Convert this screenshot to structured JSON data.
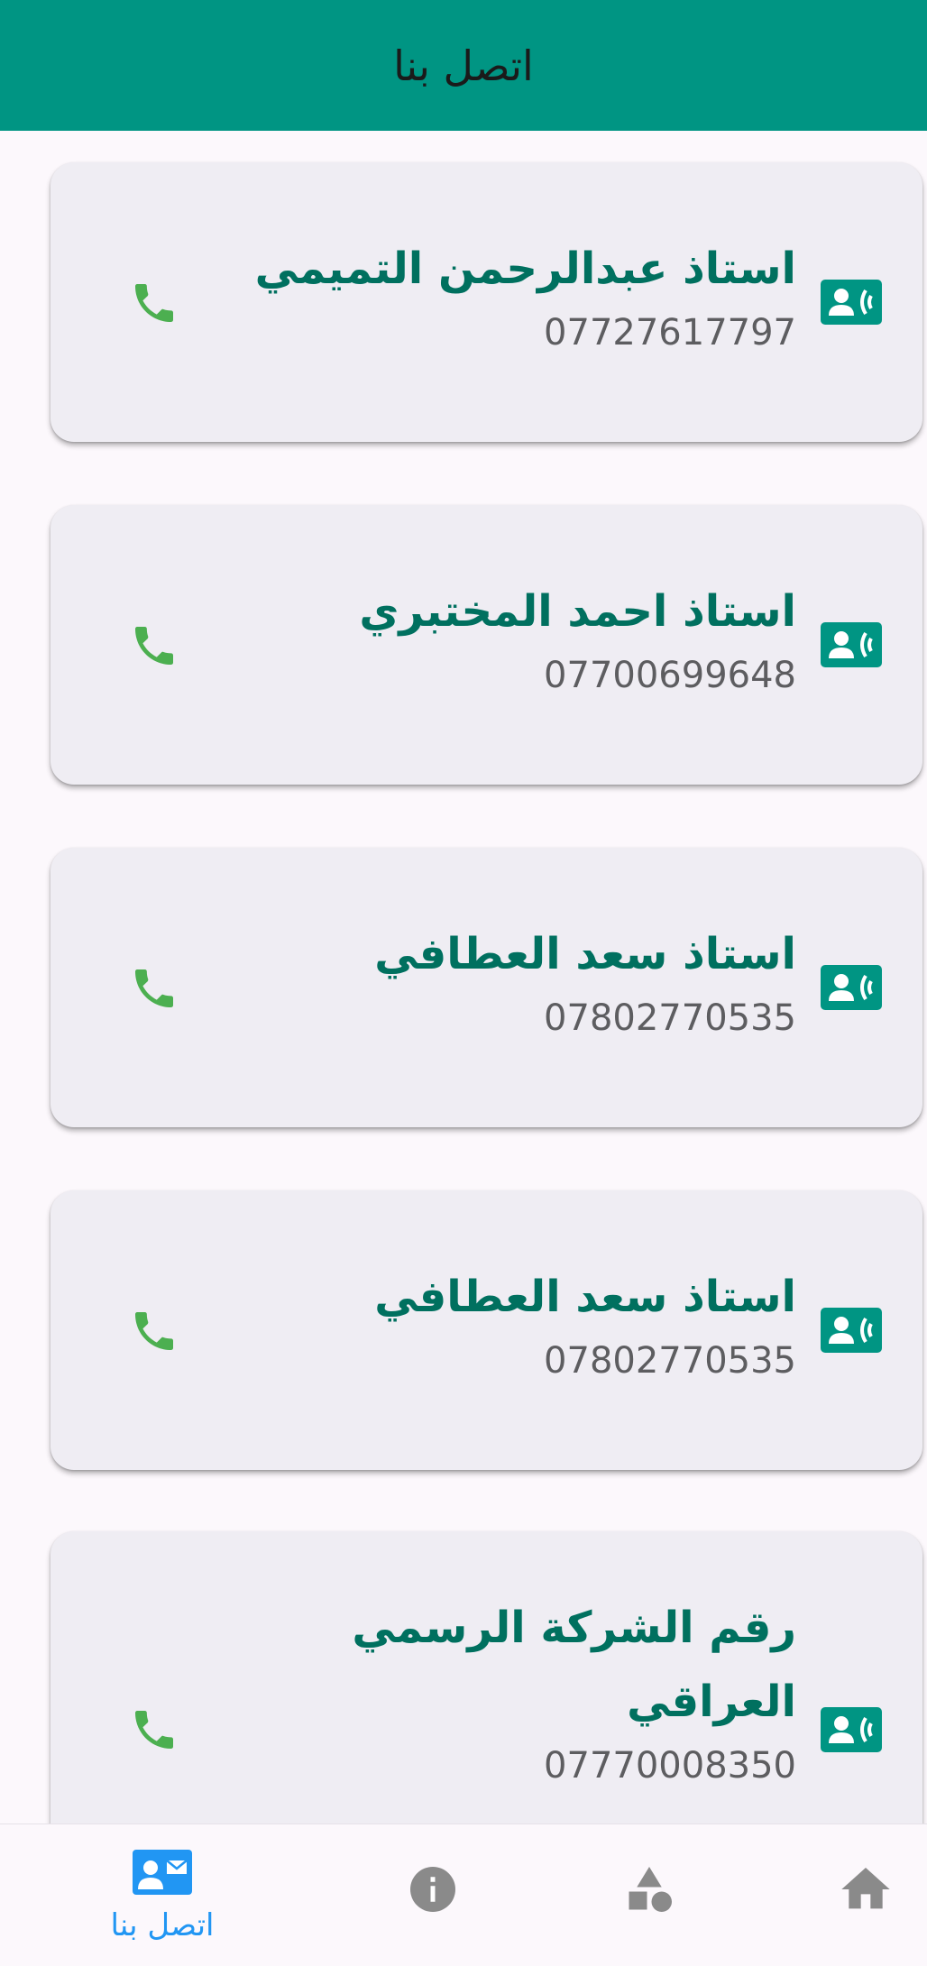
{
  "appbar": {
    "title": "اتصل بنا"
  },
  "contacts": [
    {
      "name": "استاذ عبدالرحمن التميمي",
      "phone": "07727617797"
    },
    {
      "name": "استاذ احمد المختبري",
      "phone": "07700699648"
    },
    {
      "name": "استاذ سعد العطافي",
      "phone": "07802770535"
    },
    {
      "name": "استاذ سعد العطافي",
      "phone": "07802770535"
    },
    {
      "name_line1": "رقم الشركة الرسمي",
      "name_line2": "العراقي",
      "phone": "07770008350"
    }
  ],
  "bottom_nav": {
    "items": [
      {
        "label": "اتصل بنا",
        "icon": "contact-mail-icon",
        "active": true
      },
      {
        "icon": "info-icon"
      },
      {
        "icon": "category-shapes-icon"
      },
      {
        "icon": "home-icon"
      }
    ]
  },
  "colors": {
    "primary": "#009583",
    "name_text": "#00705f",
    "call_icon": "#4caf50",
    "nav_active": "#2196f3",
    "nav_inactive": "#8a8a8a",
    "card_bg": "#efedf3"
  }
}
